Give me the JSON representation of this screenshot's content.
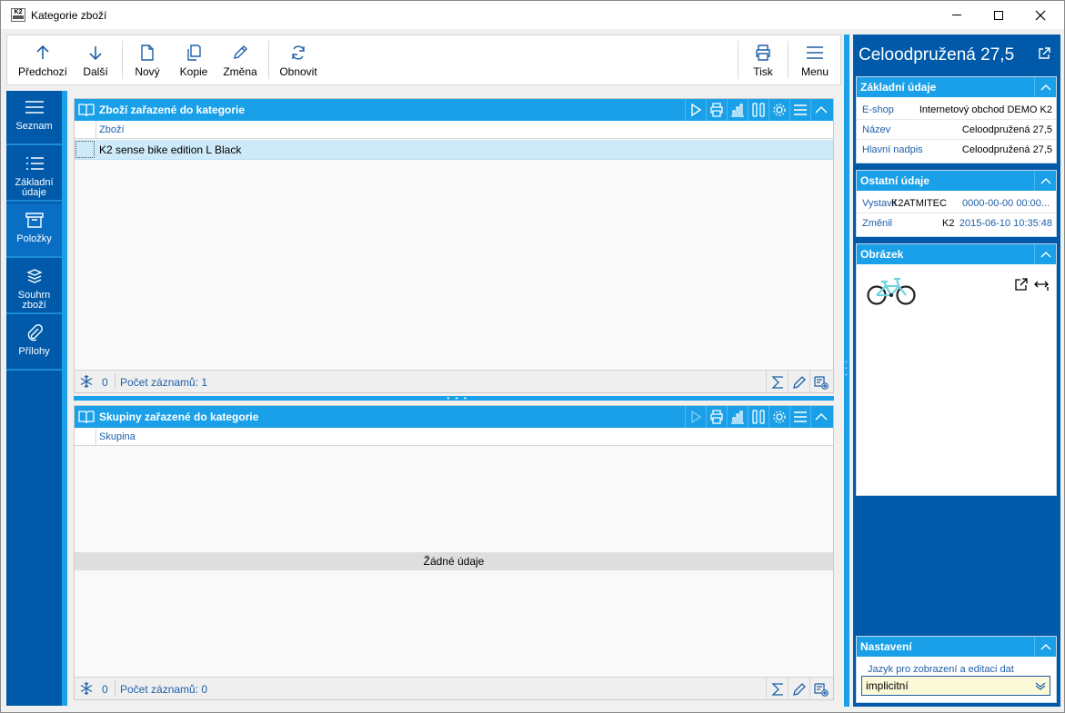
{
  "window": {
    "title": "Kategorie zboží",
    "app_icon_text": "K2"
  },
  "toolbar": {
    "prev_label": "Předchozí",
    "next_label": "Další",
    "new_label": "Nový",
    "copy_label": "Kopie",
    "edit_label": "Změna",
    "refresh_label": "Obnovit",
    "print_label": "Tisk",
    "menu_label": "Menu"
  },
  "nav": {
    "items": [
      {
        "label": "Seznam"
      },
      {
        "label": "Základní údaje"
      },
      {
        "label": "Položky"
      },
      {
        "label": "Souhrn zboží"
      },
      {
        "label": "Přílohy"
      }
    ]
  },
  "panel_goods": {
    "title": "Zboží zařazené do kategorie",
    "column": "Zboží",
    "rows": [
      "K2 sense bike edition L Black"
    ],
    "footer_filter": "0",
    "footer_count": "Počet záznamů: 1"
  },
  "panel_groups": {
    "title": "Skupiny zařazené do kategorie",
    "column": "Skupina",
    "no_data": "Žádné údaje",
    "footer_filter": "0",
    "footer_count": "Počet záznamů: 0"
  },
  "right_panel": {
    "title": "Celoodpružená 27,5",
    "basic": {
      "heading": "Základní údaje",
      "eshop_label": "E-shop",
      "eshop_value": "Internetový obchod DEMO K2",
      "name_label": "Název",
      "name_value": "Celoodpružená 27,5",
      "headline_label": "Hlavní nadpis",
      "headline_value": "Celoodpružená 27,5"
    },
    "other": {
      "heading": "Ostatní údaje",
      "issued_label": "Vystavil",
      "issued_user": "K2ATMITEC",
      "issued_date": "0000-00-00 00:00...",
      "changed_label": "Změnil",
      "changed_user": "K2",
      "changed_date": "2015-06-10 10:35:48"
    },
    "image": {
      "heading": "Obrázek"
    },
    "settings": {
      "heading": "Nastavení",
      "language_label": "Jazyk pro zobrazení a editaci dat",
      "language_value": "implicitní"
    }
  },
  "colors": {
    "accent": "#1aa0e8",
    "nav_bg": "#005aa9",
    "selected_row": "#cdeaf9",
    "link_text": "#1d5fa8"
  }
}
